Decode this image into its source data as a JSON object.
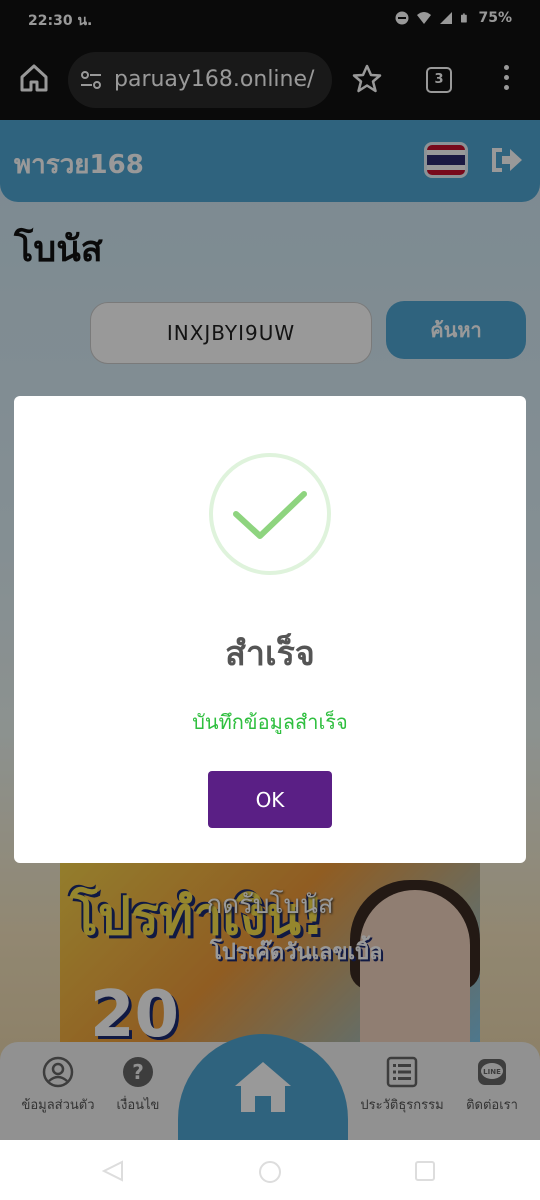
{
  "status_bar": {
    "time": "22:30 น.",
    "battery": "75%"
  },
  "browser": {
    "url": "paruay168.online/",
    "tab_count": "3"
  },
  "site": {
    "logo": "พารวย168"
  },
  "page": {
    "title": "โบนัส",
    "code_value": "INXJBYI9UW",
    "search_label": "ค้นหา"
  },
  "promo": {
    "title": "โปรทำเงิน!",
    "subtitle": "โปรเค๊ดวันเลขเบิ้ล",
    "label": "กดรับโบนัส",
    "number": "20"
  },
  "bottom_nav": {
    "items": [
      {
        "label": "ข้อมูลส่วนตัว",
        "icon": "user-circle-icon"
      },
      {
        "label": "เงื่อนไข",
        "icon": "question-circle-icon"
      },
      {
        "label": "ประวัติธุรกรรม",
        "icon": "list-icon"
      },
      {
        "label": "ติดต่อเรา",
        "icon": "line-chat-icon"
      }
    ],
    "home_icon": "home-icon"
  },
  "dialog": {
    "title": "สำเร็จ",
    "message": "บันทึกข้อมูลสำเร็จ",
    "ok_label": "OK"
  },
  "colors": {
    "brand": "#4fa6d3",
    "success": "#2fbf3f",
    "ok_button": "#5a1f85"
  }
}
